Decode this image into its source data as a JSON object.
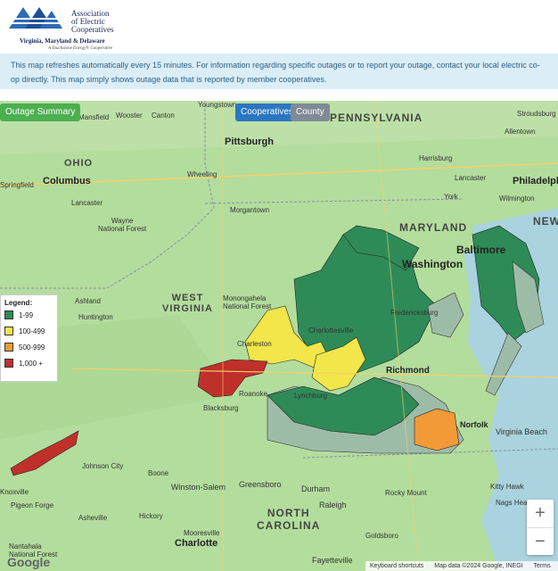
{
  "header": {
    "org_name": "Association\nof Electric\nCooperatives",
    "org_region": "Virginia, Maryland & Delaware",
    "tagline": "A Touchstone Energy® Cooperative"
  },
  "notice": {
    "text": "This map refreshes automatically every 15 minutes. For information regarding specific outages or to report your outage, contact your local electric co-op directly. This map simply shows outage data that is reported by member cooperatives."
  },
  "controls": {
    "outage_summary": "Outage Summary",
    "cooperatives": "Cooperatives",
    "county": "County"
  },
  "legend": {
    "title": "Legend:",
    "items": [
      {
        "label": "1-99",
        "color": "#2e8b57"
      },
      {
        "label": "100-499",
        "color": "#f2e64a"
      },
      {
        "label": "500-999",
        "color": "#f29a37"
      },
      {
        "label": "1,000 +",
        "color": "#c0302b"
      }
    ]
  },
  "map_labels": {
    "states": [
      "OHIO",
      "WEST\nVIRGINIA",
      "PENNSYLVANIA",
      "MARYLAND",
      "NORTH\nCAROLINA",
      "NEW"
    ],
    "cities": [
      "Pittsburgh",
      "Columbus",
      "Washington",
      "Baltimore",
      "Philadelphia",
      "Richmond",
      "Norfolk",
      "Virginia Beach",
      "Charlotte",
      "Greensboro",
      "Durham",
      "Raleigh",
      "Harrisburg",
      "Allentown",
      "Wilmington",
      "Lancaster",
      "York",
      "Huntington",
      "Charleston",
      "Roanoke",
      "Lynchburg",
      "Blacksburg",
      "Winston-Salem",
      "Rocky Mount",
      "Kitty Hawk",
      "Mansfield",
      "Wooster",
      "Canton",
      "Youngstown",
      "Wheeling",
      "Morgantown",
      "Ashland",
      "Boone",
      "Johnson City",
      "Knoxville",
      "Pigeon Forge",
      "Asheville",
      "Hickory",
      "Mooresville",
      "Goldsboro",
      "Fayetteville",
      "Nags Head",
      "Springfield",
      "Wayne\nNational Forest",
      "Monongahela\nNational Forest",
      "Nantahala\nNational Forest",
      "Charlottesville",
      "Fredericksburg",
      "Lancaster",
      "Stroudsburg"
    ]
  },
  "zoom": {
    "in": "+",
    "out": "−"
  },
  "attribution": {
    "shortcuts": "Keyboard shortcuts",
    "data": "Map data ©2024 Google, INEGI",
    "terms": "Terms"
  },
  "google": "Google"
}
